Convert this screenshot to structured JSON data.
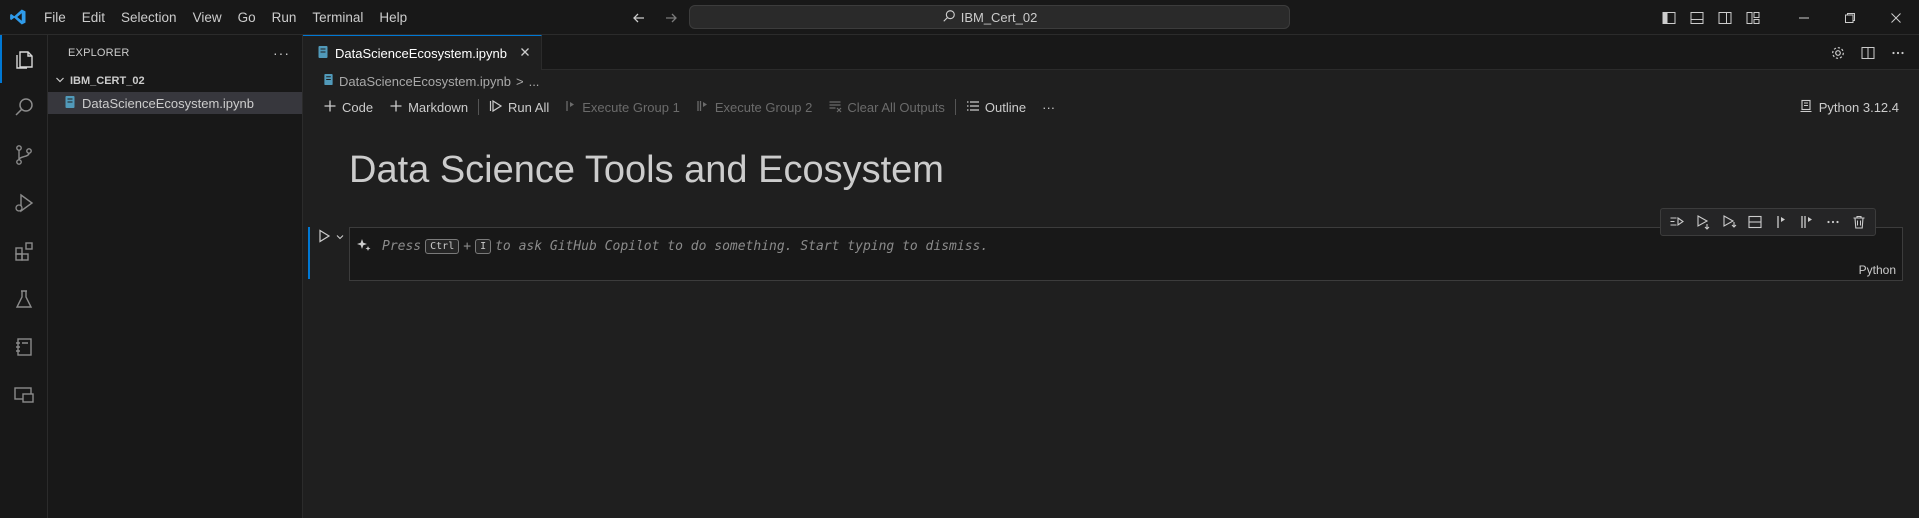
{
  "titlebar": {
    "menu": [
      "File",
      "Edit",
      "Selection",
      "View",
      "Go",
      "Run",
      "Terminal",
      "Help"
    ],
    "search_text": "IBM_Cert_02",
    "icons": {
      "logo": "vscode-logo",
      "back": "arrow-left-icon",
      "forward": "arrow-right-icon",
      "search": "search-icon"
    }
  },
  "activitybar": {
    "items": [
      "explorer-icon",
      "search-icon",
      "source-control-icon",
      "run-debug-icon",
      "extensions-icon",
      "testing-icon",
      "notebook-icon",
      "remote-explorer-icon"
    ]
  },
  "sidebar": {
    "title": "EXPLORER",
    "more": "···",
    "folder": "IBM_CERT_02",
    "files": [
      "DataScienceEcosystem.ipynb"
    ]
  },
  "editor": {
    "tab_label": "DataScienceEcosystem.ipynb",
    "breadcrumb": {
      "file": "DataScienceEcosystem.ipynb",
      "sep": ">",
      "more": "..."
    },
    "toolbar": {
      "code": "Code",
      "markdown": "Markdown",
      "run_all": "Run All",
      "execute_group_1": "Execute Group 1",
      "execute_group_2": "Execute Group 2",
      "clear_outputs": "Clear All Outputs",
      "outline": "Outline",
      "more": "···"
    },
    "kernel": "Python 3.12.4"
  },
  "notebook": {
    "markdown_heading": "Data Science Tools and Ecosystem",
    "cell": {
      "hint_press": "Press",
      "key1": "Ctrl",
      "plus": "+",
      "key2": "I",
      "hint_rest": "to ask GitHub Copilot to do something. Start typing to dismiss.",
      "language": "Python"
    }
  },
  "colors": {
    "accent": "#0078d4",
    "background": "#1f1f1f",
    "sidebar": "#181818"
  }
}
